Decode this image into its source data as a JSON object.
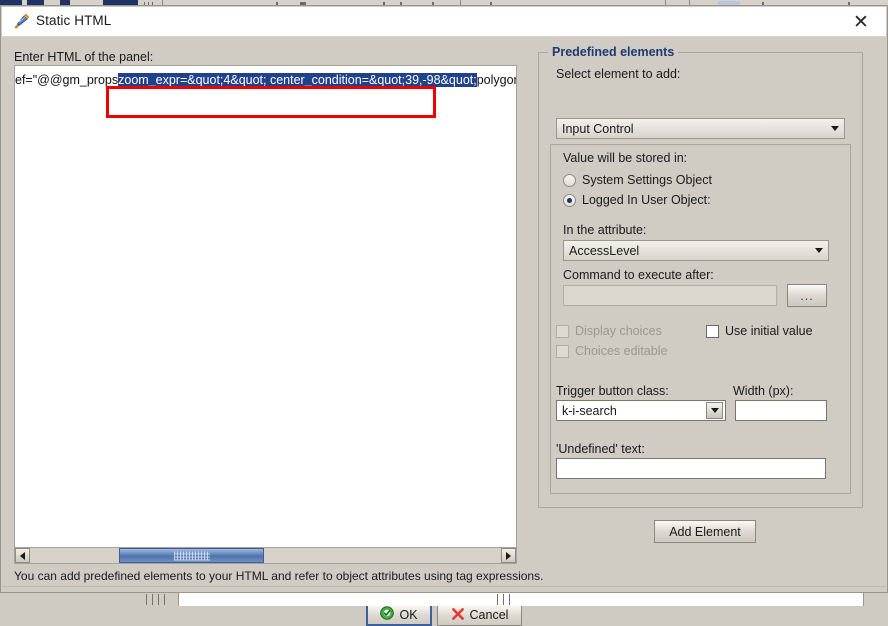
{
  "window": {
    "title": "Static HTML",
    "icon": "paintbrush-icon",
    "close_label": "✕"
  },
  "left_panel": {
    "editor_label": "Enter HTML of the panel:",
    "editor_text_before": "ef=\"@@gm_props",
    "editor_text_selected": "zoom_expr=&quot;4&quot; center_condition=&quot;39,-98&quot;",
    "editor_text_after": "polygon_attr_nam",
    "hint": "You can add predefined elements to your HTML and refer to object attributes using tag expressions.",
    "scroll_left_arrow": "◄",
    "scroll_right_arrow": "►"
  },
  "right_panel": {
    "group_title": "Predefined elements",
    "select_element_label": "Select element to add:",
    "select_element_value": "Input Control",
    "inner": {
      "value_stored_label": "Value will be stored in:",
      "radios": [
        {
          "label": "System Settings Object",
          "checked": false
        },
        {
          "label": "Logged In User Object:",
          "checked": true
        }
      ],
      "attribute_label": "In the attribute:",
      "attribute_value": "AccessLevel",
      "command_label": "Command to execute after:",
      "command_value": "",
      "browse_button": "...",
      "checkboxes": [
        {
          "label": "Display choices",
          "checked": false,
          "enabled": false
        },
        {
          "label": "Choices editable",
          "checked": false,
          "enabled": false
        },
        {
          "label": "Use initial value",
          "checked": false,
          "enabled": true
        }
      ],
      "trigger_class_label": "Trigger button class:",
      "trigger_class_value": "k-i-search",
      "width_label": "Width (px):",
      "width_value": "",
      "undefined_label": "'Undefined' text:",
      "undefined_value": ""
    },
    "add_element_button": "Add Element"
  },
  "footer": {
    "ok_label": "OK",
    "cancel_label": "Cancel"
  },
  "annotation": {
    "type": "red-highlight-rectangle",
    "color": "#ef0000"
  },
  "colors": {
    "dialog_bg": "#d0ccc4",
    "titlebar_bg": "#ffffff",
    "selection_bg": "#20418c",
    "group_title": "#1d3a6e",
    "scroll_thumb": "#4f73ad",
    "annotation_red": "#ef0000"
  }
}
